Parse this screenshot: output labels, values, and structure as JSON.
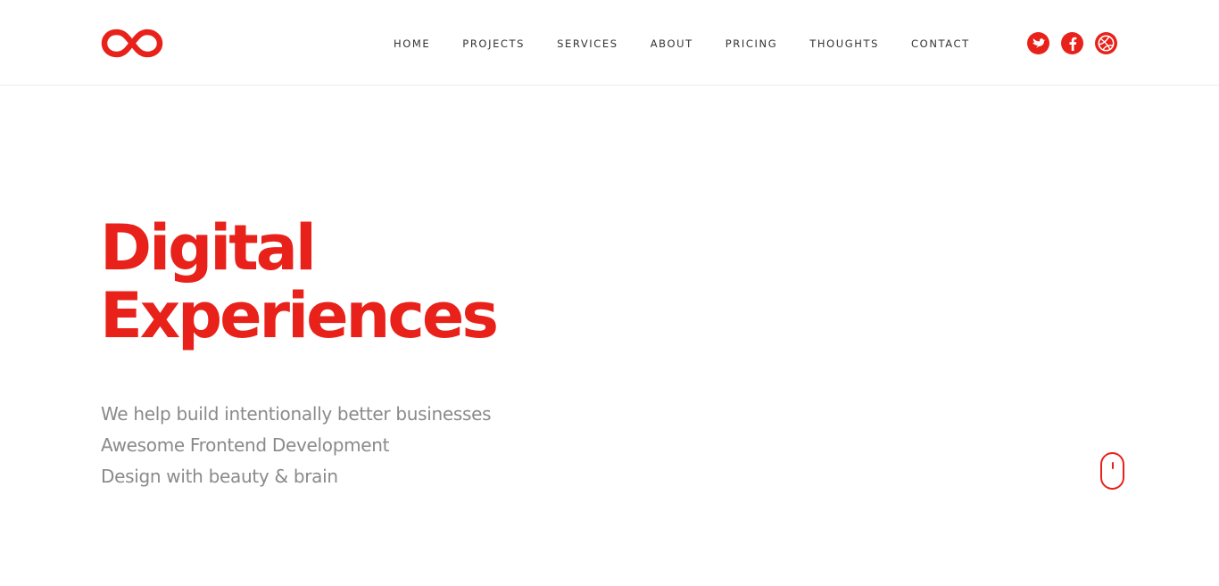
{
  "brand": {
    "accent_color": "#e8211a",
    "logo_icon": "infinity-logo"
  },
  "nav": {
    "items": [
      {
        "label": "HOME"
      },
      {
        "label": "PROJECTS"
      },
      {
        "label": "SERVICES"
      },
      {
        "label": "ABOUT"
      },
      {
        "label": "PRICING"
      },
      {
        "label": "THOUGHTS"
      },
      {
        "label": "CONTACT"
      }
    ]
  },
  "social": {
    "icons": [
      "twitter-icon",
      "facebook-icon",
      "dribbble-icon"
    ]
  },
  "hero": {
    "title_line1": "Digital",
    "title_line2": "Experiences",
    "lines": [
      "We help build intentionally better businesses",
      "Awesome Frontend Development",
      "Design with beauty & brain"
    ],
    "text_color": "#8a8a8a"
  },
  "scroll_indicator": {
    "icon": "mouse-scroll-icon"
  }
}
